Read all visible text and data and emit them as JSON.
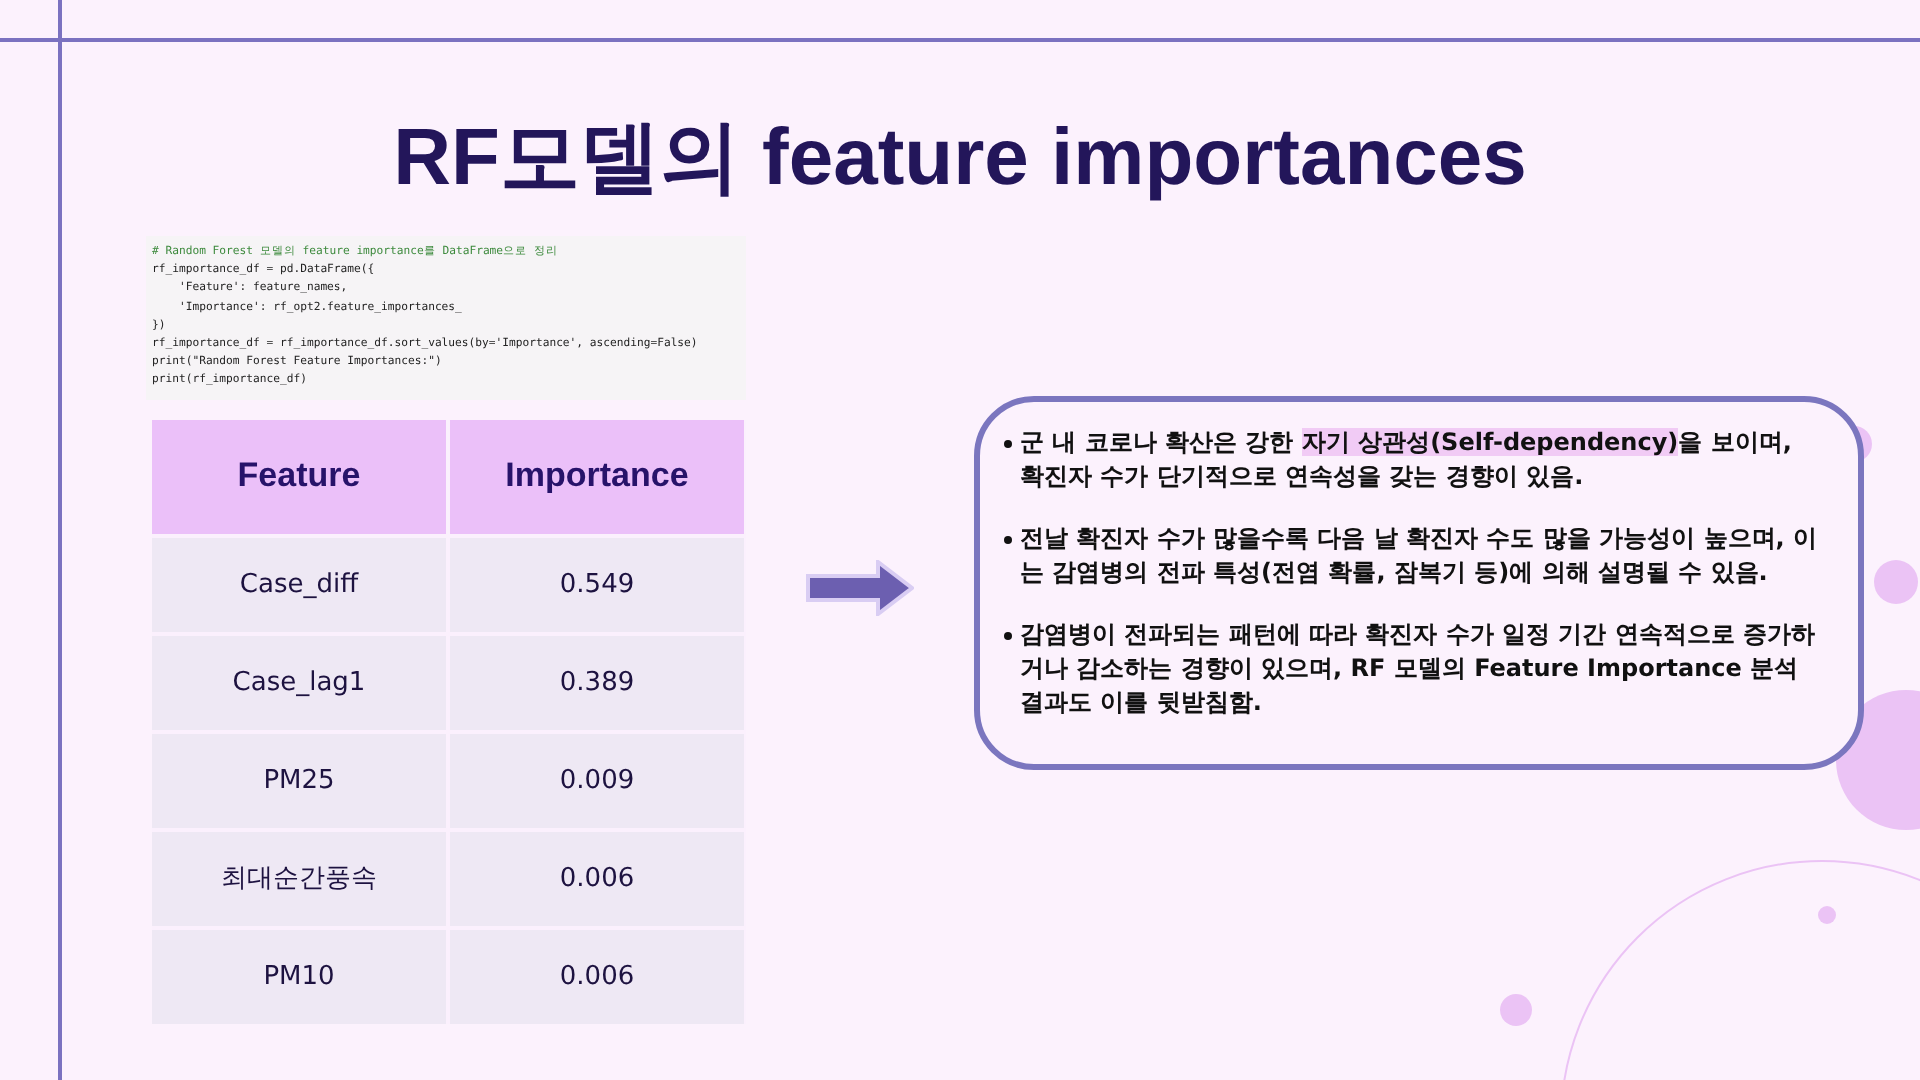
{
  "title": "RF모델의 feature importances",
  "code": [
    {
      "kind": "comment",
      "text": "# Random Forest 모델의 feature importance를 DataFrame으로 정리"
    },
    {
      "kind": "code",
      "text": "rf_importance_df = pd.DataFrame({"
    },
    {
      "kind": "code",
      "text": "    'Feature': feature_names,"
    },
    {
      "kind": "code",
      "text": "    'Importance': rf_opt2.feature_importances_"
    },
    {
      "kind": "code",
      "text": "})"
    },
    {
      "kind": "code",
      "text": "rf_importance_df = rf_importance_df.sort_values(by='Importance', ascending=False)"
    },
    {
      "kind": "code",
      "text": "print(\"Random Forest Feature Importances:\")"
    },
    {
      "kind": "code",
      "text": "print(rf_importance_df)"
    }
  ],
  "table": {
    "columns": [
      "Feature",
      "Importance"
    ],
    "rows": [
      [
        "Case_diff",
        "0.549"
      ],
      [
        "Case_lag1",
        "0.389"
      ],
      [
        "PM25",
        "0.009"
      ],
      [
        "최대순간풍속",
        "0.006"
      ],
      [
        "PM10",
        "0.006"
      ]
    ]
  },
  "bullets": [
    [
      {
        "text": "군 내 코로나 확산은 강한 ",
        "highlight": false
      },
      {
        "text": "자기 상관성(Self-dependency)",
        "highlight": true
      },
      {
        "text": "을 보이며, 확진자 수가 단기적으로 연속성을 갖는 경향이 있음.",
        "highlight": false
      }
    ],
    [
      {
        "text": "전날 확진자 수가 많을수록 다음 날 확진자 수도 많을 가능성이 높으며, 이는 감염병의 전파 특성(전염 확률, 잠복기 등)에 의해 설명될 수 있음.",
        "highlight": false
      }
    ],
    [
      {
        "text": "감염병이 전파되는 패턴에 따라 확진자 수가 일정 기간 연속적으로 증가하거나 감소하는 경향이 있으며, RF 모델의 Feature Importance 분석 결과도 이를 뒷받침함.",
        "highlight": false
      }
    ]
  ]
}
